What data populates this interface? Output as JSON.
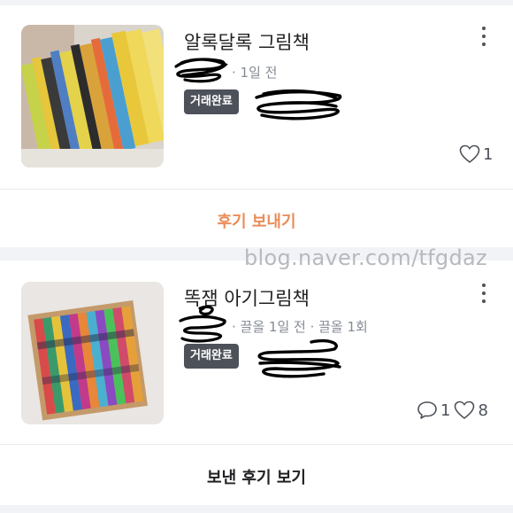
{
  "colors": {
    "accent": "#e98e5a",
    "badge_bg": "#4d5159",
    "muted": "#868b94",
    "text": "#212124",
    "background": "#f2f3f6"
  },
  "items": [
    {
      "title": "알록달록 그림책",
      "meta": "· 1일 전",
      "badge": "거래완료",
      "like_count": "1",
      "action_label": "후기 보내기"
    },
    {
      "title": "똑잼 아기그림책",
      "meta": "· 끌올 1일 전 · 끌올 1회",
      "badge": "거래완료",
      "comment_count": "1",
      "like_count": "8",
      "action_label": "보낸 후기 보기"
    }
  ],
  "watermark": "blog.naver.com/tfgdaz",
  "icons": [
    "more-vertical-icon",
    "heart-icon",
    "chat-bubble-icon"
  ]
}
